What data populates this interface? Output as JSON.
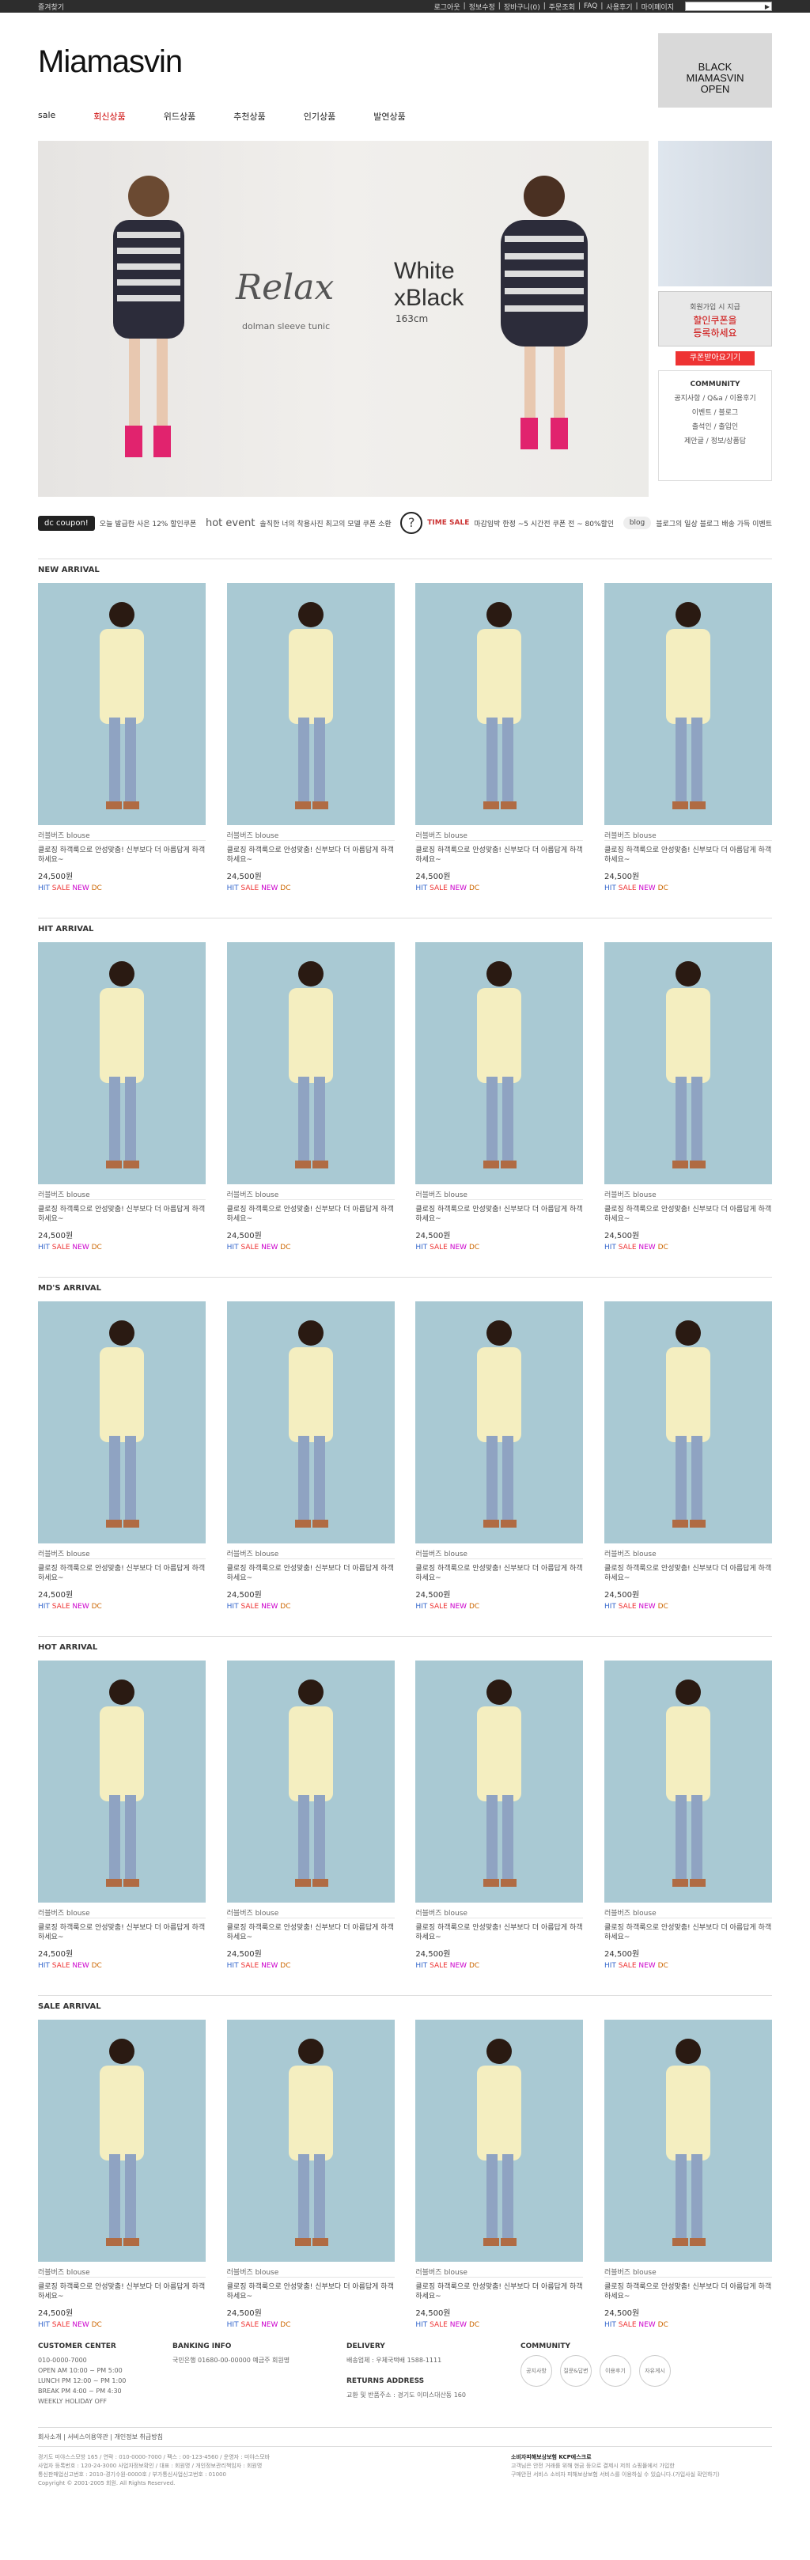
{
  "topbar": {
    "left": "즐겨찾기",
    "links": [
      "로그아웃",
      "정보수정",
      "장바구니(0)",
      "주문조회",
      "FAQ",
      "사용후기",
      "마이페이지"
    ],
    "search_go": "▶"
  },
  "header": {
    "logo": "Miamasvin",
    "side_banner": [
      "BLACK",
      "MIAMASVIN",
      "OPEN"
    ]
  },
  "nav": [
    "sale",
    "회신상품",
    "위드상품",
    "추천상품",
    "인기상품",
    "발연상품"
  ],
  "hero": {
    "relax": "Relax",
    "relax_sub": "dolman sleeve tunic",
    "white": "White",
    "xblack": "xBlack",
    "cm": "163cm"
  },
  "side": {
    "coupon_small": "회원가입 시 지급",
    "coupon_line1": "할인쿠폰을",
    "coupon_line2": "등록하세요",
    "coupon_button": "쿠폰받아요기기",
    "community_title": "COMMUNITY",
    "community_items": [
      "공지사항 / Q&a / 이용후기",
      "이벤트 / 블로그",
      "출석인 / 출입인",
      "제안글 / 정보/상품답"
    ]
  },
  "promo": [
    {
      "badge": "dc coupon!",
      "text": "오늘 발급한 사은 12% 할인쿠폰"
    },
    {
      "badge": "hot event",
      "text": "솔직한 너의 착용사진 최고의 모델 쿠폰 소환"
    },
    {
      "badge": "TIME SALE",
      "text": "마감임박 한정 ~5 시간전 쿠폰 전 ~ 80%할인"
    },
    {
      "badge": "blog",
      "text": "블로그의 일상 블로그 배송 가득 이벤트"
    }
  ],
  "sections": [
    {
      "title": "NEW ARRIVAL"
    },
    {
      "title": "HIT ARRIVAL"
    },
    {
      "title": "MD'S ARRIVAL"
    },
    {
      "title": "HOT ARRIVAL"
    },
    {
      "title": "SALE ARRIVAL"
    }
  ],
  "product": {
    "category": "러블버즈 blouse",
    "desc": "클로징 하객룩으로 안성맞춤! 신부보다 더 아름답게 하객하세요~",
    "price": "24,500원",
    "tag_hit": "HIT",
    "tag_sale": "SALE",
    "tag_new": "NEW",
    "tag_dc": "DC"
  },
  "footer": {
    "customer_title": "CUSTOMER CENTER",
    "customer_lines": [
      "010-0000-7000",
      "OPEN AM 10:00 ~ PM 5:00",
      "LUNCH PM 12:00 ~ PM 1:00",
      "BREAK PM 4:00 ~ PM 4:30",
      "WEEKLY HOLIDAY OFF"
    ],
    "bank_title": "BANKING INFO",
    "bank_lines": [
      "국민은행 01680-00-00000 예금주 회원명"
    ],
    "delivery_title": "DELIVERY",
    "delivery_lines": [
      "배송업체 : 우체국택배 1588-1111"
    ],
    "return_title": "RETURNS ADDRESS",
    "return_lines": [
      "교환 및 반품주소 : 경기도 이미스대산동 160"
    ],
    "community_title": "COMMUNITY",
    "community_circles": [
      "공지사항",
      "질문&답변",
      "이용후기",
      "자유게시"
    ],
    "links": "회사소개 | 서비스이용약관 | 개인정보 취급방침",
    "info_lines": [
      "경기도 미야스스모방 165 / 연락 : 010-0000-7000 / 팩스 : 00-123-4560 / 운영자 : 미야스모바",
      "사업자 등록번호 : 120-24-3000 사업자정보확인 / 대표 : 회원명 / 개인정보관리책임자 : 회원명",
      "통신판매업신고번호 : 2010-경기수원-0000호 / 부가통신사업신고번호 : 01000",
      "Copyright © 2001-2005 회원. All Rights Reserved."
    ],
    "escrow_title": "소비자피해보상보험 KCP에스크로",
    "escrow_lines": [
      "고객님은 안전 거래를 위해 현금 등으로 결제시 저희 쇼핑몰에서 가입한",
      "구매안전 서비스 소비자 피해보상보험 서비스를 이용하실 수 있습니다.(가입사실 확인하기)"
    ]
  }
}
